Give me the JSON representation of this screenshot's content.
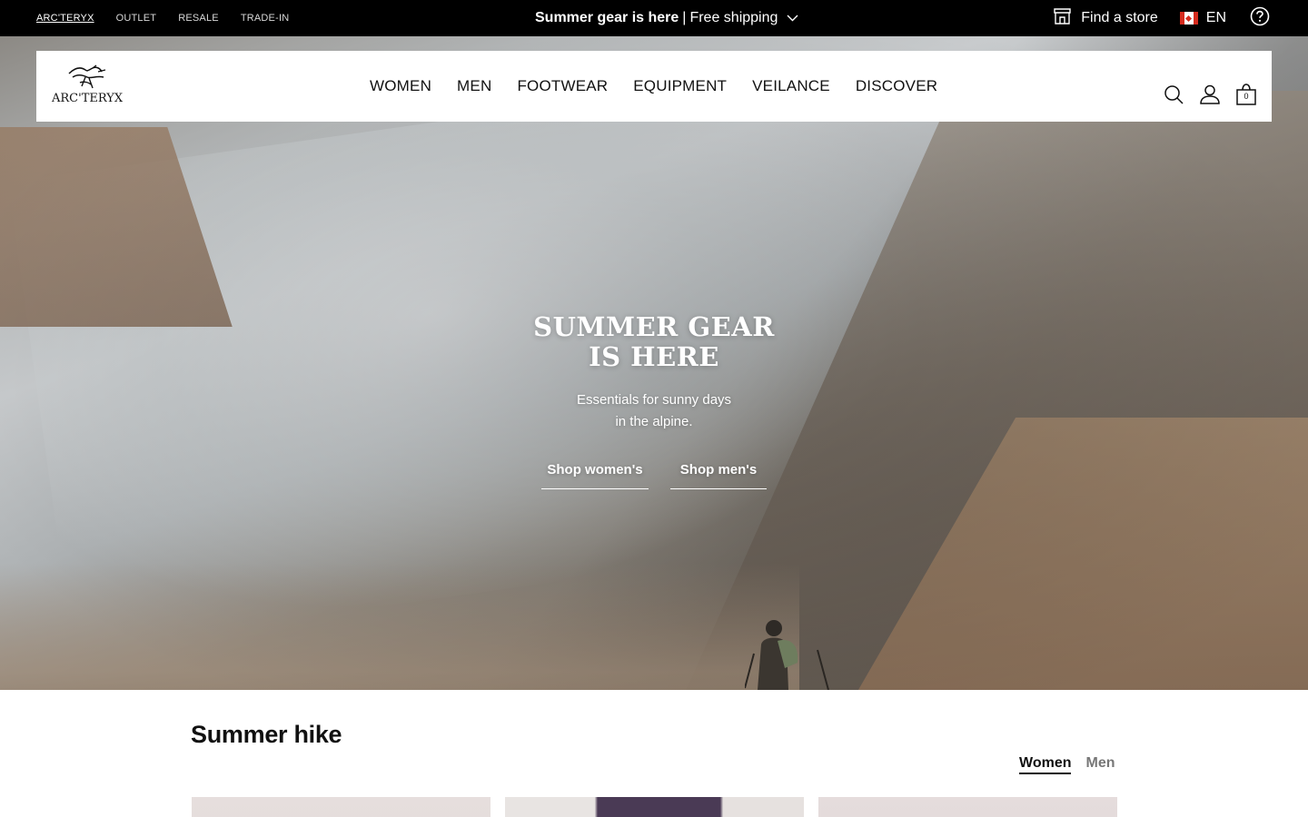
{
  "topbar": {
    "sites": [
      {
        "label": "ARC'TERYX",
        "active": true
      },
      {
        "label": "OUTLET",
        "active": false
      },
      {
        "label": "RESALE",
        "active": false
      },
      {
        "label": "TRADE-IN",
        "active": false
      }
    ],
    "promo_bold": "Summer gear is here",
    "promo_sep": "|",
    "promo_rest": "Free shipping",
    "promo_icon": "chevron-down-icon",
    "find_store": "Find a store",
    "store_icon": "store-icon",
    "language": "EN",
    "flag": "canada-flag",
    "help_icon": "help-icon"
  },
  "header": {
    "logo_text": "ARC'TERYX",
    "nav": [
      "WOMEN",
      "MEN",
      "FOOTWEAR",
      "EQUIPMENT",
      "VEILANCE",
      "DISCOVER"
    ],
    "icons": [
      "search-icon",
      "account-icon",
      "bag-icon"
    ],
    "bag_count": "0"
  },
  "hero": {
    "title_line1": "SUMMER GEAR",
    "title_line2": "IS HERE",
    "subtitle_line1": "Essentials for sunny days",
    "subtitle_line2": "in the alpine.",
    "cta_women": "Shop women's",
    "cta_men": "Shop men's"
  },
  "section": {
    "title": "Summer hike",
    "tabs": [
      {
        "label": "Women",
        "active": true
      },
      {
        "label": "Men",
        "active": false
      }
    ]
  },
  "colors": {
    "topbar_bg": "#000000",
    "text": "#111111",
    "inactive_tab": "#777777",
    "flag_red": "#d52b1e"
  }
}
